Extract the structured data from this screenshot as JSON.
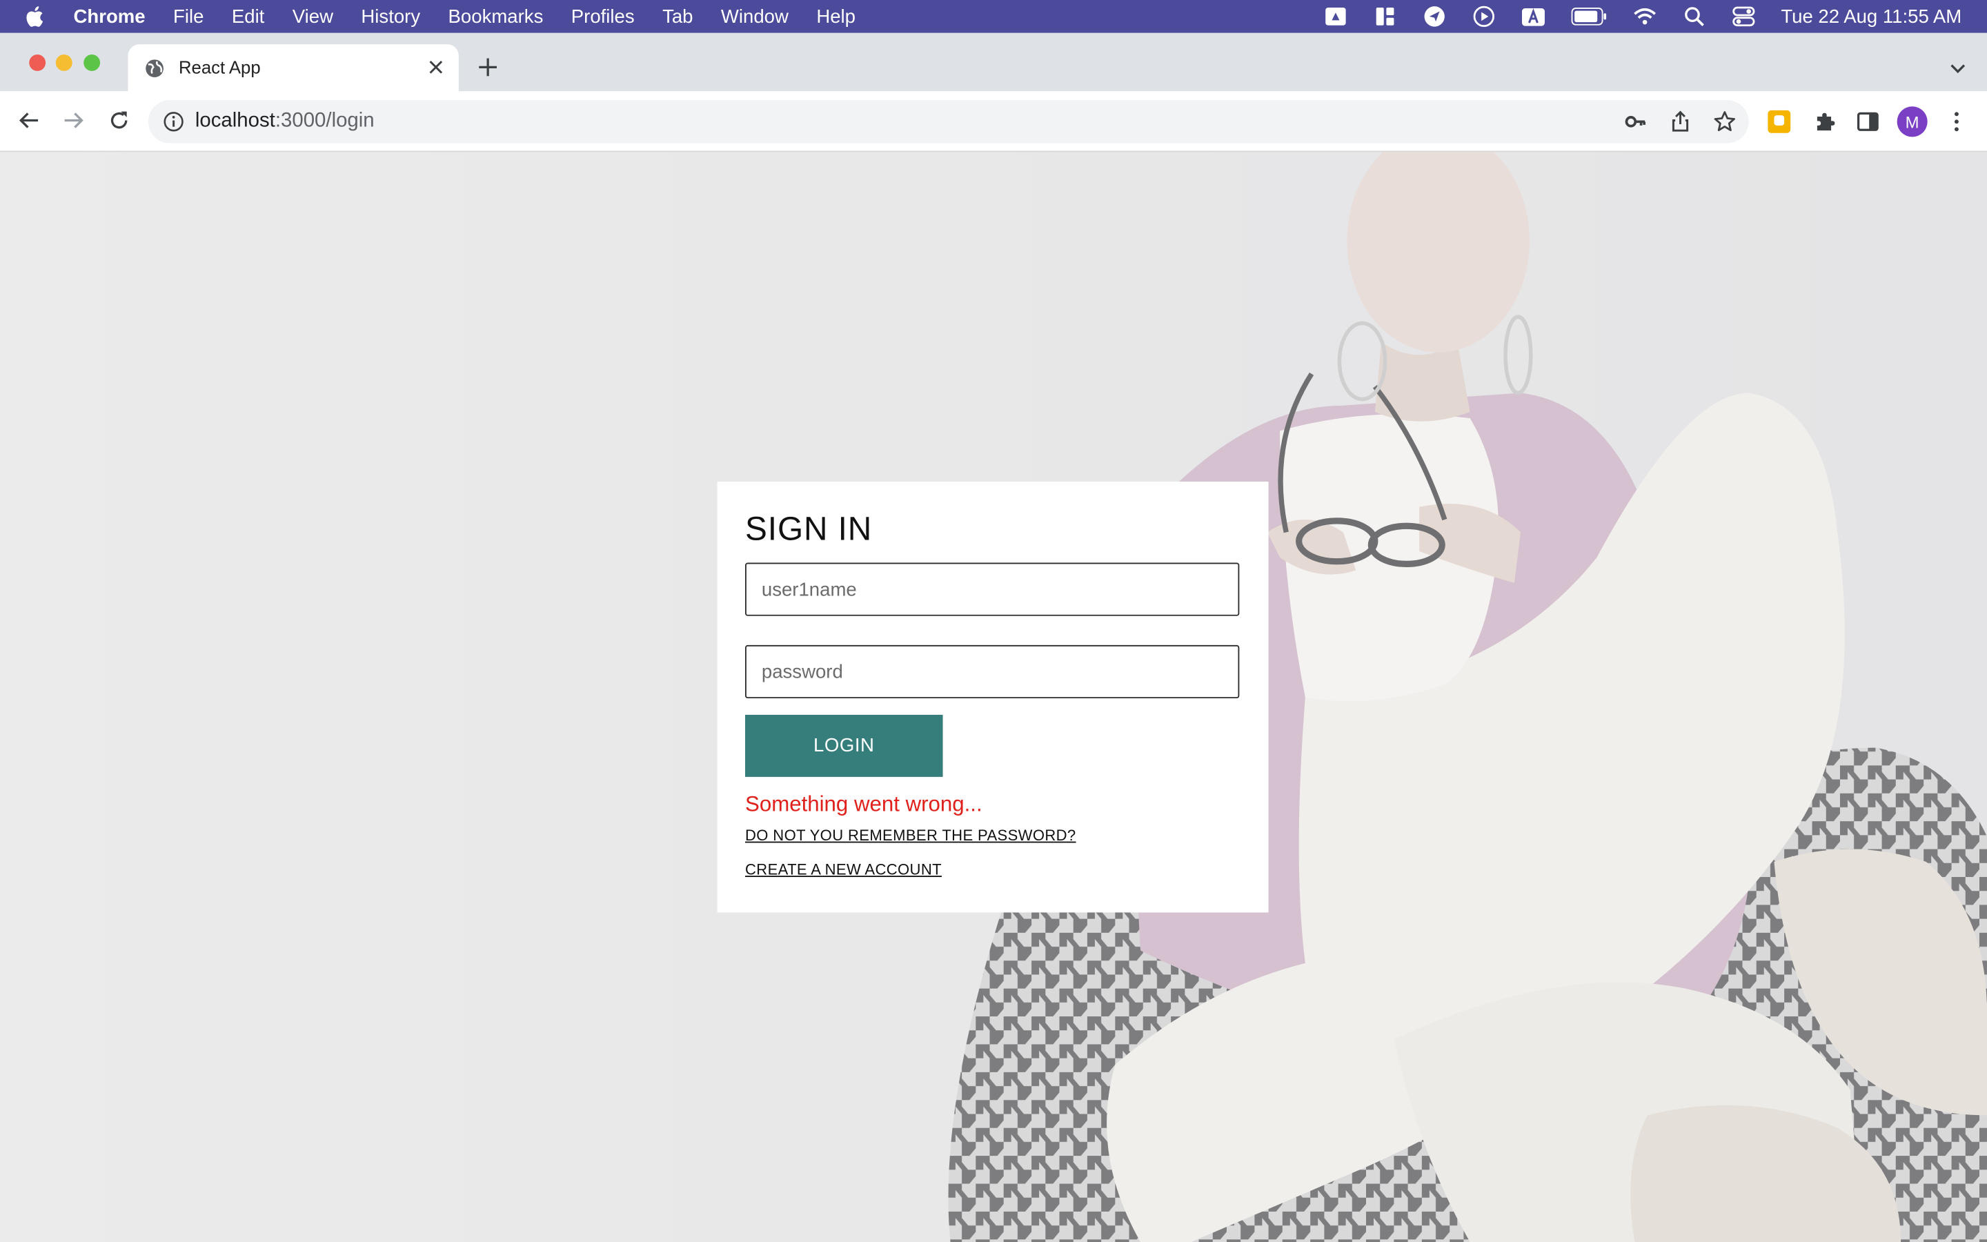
{
  "menubar": {
    "app": "Chrome",
    "items": [
      "File",
      "Edit",
      "View",
      "History",
      "Bookmarks",
      "Profiles",
      "Tab",
      "Window",
      "Help"
    ],
    "clock": "Tue 22 Aug  11:55 AM",
    "color": "#4c4a9a"
  },
  "browser": {
    "tab_title": "React App",
    "url_host": "localhost",
    "url_path": ":3000/login",
    "avatar_letter": "M"
  },
  "login": {
    "title": "SIGN IN",
    "username_placeholder": "user1name",
    "password_placeholder": "password",
    "login_label": "LOGIN",
    "error": "Something went wrong...",
    "forgot_link": "DO NOT YOU REMEMBER THE PASSWORD?",
    "create_link": "CREATE A NEW ACCOUNT",
    "button_color": "#367e7c",
    "error_color": "#e0201a"
  }
}
